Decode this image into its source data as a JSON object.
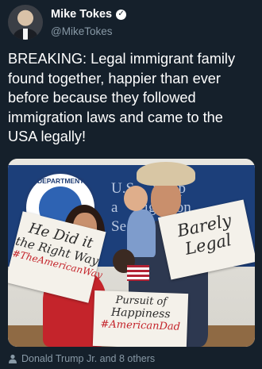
{
  "tweet": {
    "author": {
      "name": "Mike Tokes",
      "handle": "@MikeTokes",
      "verified_glyph": "✓"
    },
    "text": "BREAKING: Legal immigrant family found together, happier than ever before because they followed immigration laws and came to the USA legally!",
    "media": {
      "seal_text": "DEPARTMENT",
      "banner_text": "U.S.    nship\na       igration\nSe",
      "signs": {
        "left": {
          "line1": "He Did it",
          "line2": "the Right Way",
          "hashtag": "#TheAmericanWay"
        },
        "right": {
          "line1": "Barely",
          "line2": "Legal"
        },
        "bottom": {
          "line1": "Pursuit of",
          "line2": "Happiness",
          "hashtag": "#AmericanDad"
        }
      }
    },
    "social_context": {
      "icon": "person-icon",
      "text": "Donald Trump Jr. and 8 others"
    }
  },
  "colors": {
    "background": "#15202b",
    "secondary_text": "#8899a6",
    "primary_text": "#ffffff"
  }
}
